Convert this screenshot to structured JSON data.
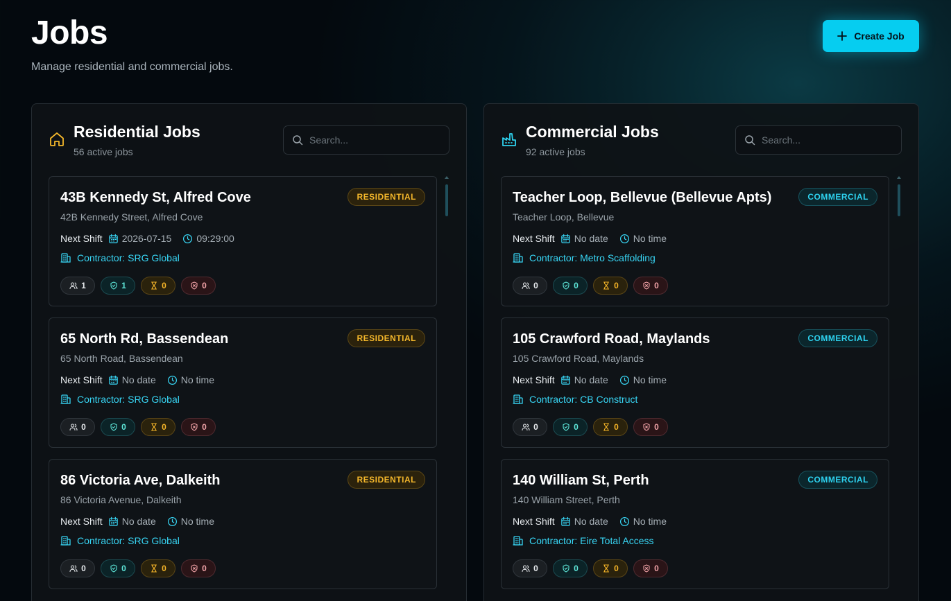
{
  "page": {
    "title": "Jobs",
    "subtitle": "Manage residential and commercial jobs.",
    "create_label": "Create Job"
  },
  "colors": {
    "accent": "#06cdf0",
    "residential": "#f5b82b",
    "commercial": "#2ed3f0",
    "approved": "#5ee6d8",
    "rejected": "#f2a3a8"
  },
  "panels": [
    {
      "kind": "res",
      "icon": "home-icon",
      "title": "Residential Jobs",
      "count": "56 active jobs",
      "search_placeholder": "Search...",
      "jobs": [
        {
          "title": "43B Kennedy St, Alfred Cove",
          "address": "42B Kennedy Street, Alfred Cove",
          "badge": "RESIDENTIAL",
          "shift_label": "Next Shift",
          "date": "2026-07-15",
          "time": "09:29:00",
          "contractor": "Contractor: SRG Global",
          "stats": {
            "people": "1",
            "approved": "1",
            "pending": "0",
            "rejected": "0"
          }
        },
        {
          "title": "65 North Rd, Bassendean",
          "address": "65 North Road, Bassendean",
          "badge": "RESIDENTIAL",
          "shift_label": "Next Shift",
          "date": "No date",
          "time": "No time",
          "contractor": "Contractor: SRG Global",
          "stats": {
            "people": "0",
            "approved": "0",
            "pending": "0",
            "rejected": "0"
          }
        },
        {
          "title": "86 Victoria Ave, Dalkeith",
          "address": "86 Victoria Avenue, Dalkeith",
          "badge": "RESIDENTIAL",
          "shift_label": "Next Shift",
          "date": "No date",
          "time": "No time",
          "contractor": "Contractor: SRG Global",
          "stats": {
            "people": "0",
            "approved": "0",
            "pending": "0",
            "rejected": "0"
          }
        }
      ]
    },
    {
      "kind": "com",
      "icon": "factory-icon",
      "title": "Commercial Jobs",
      "count": "92 active jobs",
      "search_placeholder": "Search...",
      "jobs": [
        {
          "title": "Teacher Loop, Bellevue (Bellevue Apts)",
          "address": "Teacher Loop, Bellevue",
          "badge": "COMMERCIAL",
          "shift_label": "Next Shift",
          "date": "No date",
          "time": "No time",
          "contractor": "Contractor: Metro Scaffolding",
          "stats": {
            "people": "0",
            "approved": "0",
            "pending": "0",
            "rejected": "0"
          }
        },
        {
          "title": "105 Crawford Road, Maylands",
          "address": "105 Crawford Road, Maylands",
          "badge": "COMMERCIAL",
          "shift_label": "Next Shift",
          "date": "No date",
          "time": "No time",
          "contractor": "Contractor: CB Construct",
          "stats": {
            "people": "0",
            "approved": "0",
            "pending": "0",
            "rejected": "0"
          }
        },
        {
          "title": "140 William St, Perth",
          "address": "140 William Street, Perth",
          "badge": "COMMERCIAL",
          "shift_label": "Next Shift",
          "date": "No date",
          "time": "No time",
          "contractor": "Contractor: Eire Total Access",
          "stats": {
            "people": "0",
            "approved": "0",
            "pending": "0",
            "rejected": "0"
          }
        }
      ]
    }
  ]
}
